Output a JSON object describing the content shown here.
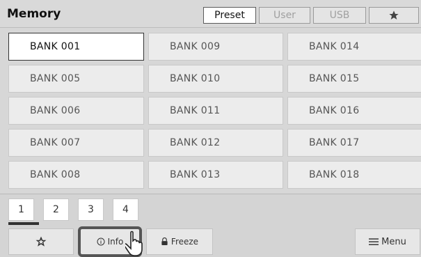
{
  "header": {
    "title": "Memory"
  },
  "tabs": [
    {
      "label": "Preset",
      "active": true
    },
    {
      "label": "User",
      "active": false
    },
    {
      "label": "USB",
      "active": false
    },
    {
      "icon": "star-icon",
      "active": false
    }
  ],
  "banks": [
    [
      "BANK 001",
      "BANK 009",
      "BANK 014"
    ],
    [
      "BANK 005",
      "BANK 010",
      "BANK 015"
    ],
    [
      "BANK 006",
      "BANK 011",
      "BANK 016"
    ],
    [
      "BANK 007",
      "BANK 012",
      "BANK 017"
    ],
    [
      "BANK 008",
      "BANK 013",
      "BANK 018"
    ]
  ],
  "selected_bank": "BANK 001",
  "pages": {
    "items": [
      "1",
      "2",
      "3",
      "4"
    ],
    "current": "1"
  },
  "buttons": {
    "favorite_icon": "star-outline-icon",
    "info": "Info",
    "freeze": "Freeze",
    "menu": "Menu"
  },
  "colors": {
    "selected_border": "#333333",
    "tab_active_bg": "#ffffff"
  }
}
